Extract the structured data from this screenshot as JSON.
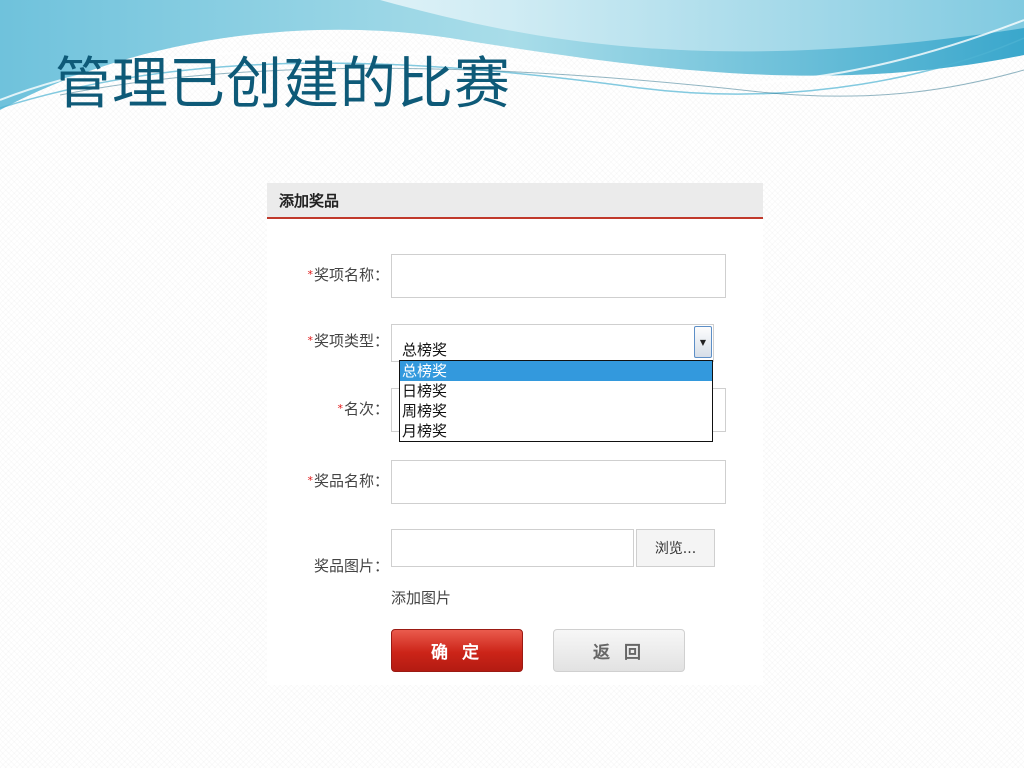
{
  "slide": {
    "title": "管理已创建的比赛"
  },
  "panel": {
    "title": "添加奖品"
  },
  "form": {
    "required_mark": "*",
    "award_name": {
      "label": "奖项名称：",
      "value": ""
    },
    "award_type": {
      "label": "奖项类型：",
      "selected": "总榜奖",
      "options": [
        "总榜奖",
        "日榜奖",
        "周榜奖",
        "月榜奖"
      ]
    },
    "rank": {
      "label": "名次：",
      "value": ""
    },
    "prize_name": {
      "label": "奖品名称：",
      "value": ""
    },
    "prize_image": {
      "label": "奖品图片：",
      "browse_label": "浏览...",
      "add_link": "添加图片"
    }
  },
  "buttons": {
    "confirm": "确 定",
    "back": "返 回"
  },
  "colors": {
    "title": "#0e5a78",
    "accent": "#c0392b",
    "selected_option": "#3399dd"
  },
  "icons": {
    "select_arrow": "chevron-down-icon"
  }
}
